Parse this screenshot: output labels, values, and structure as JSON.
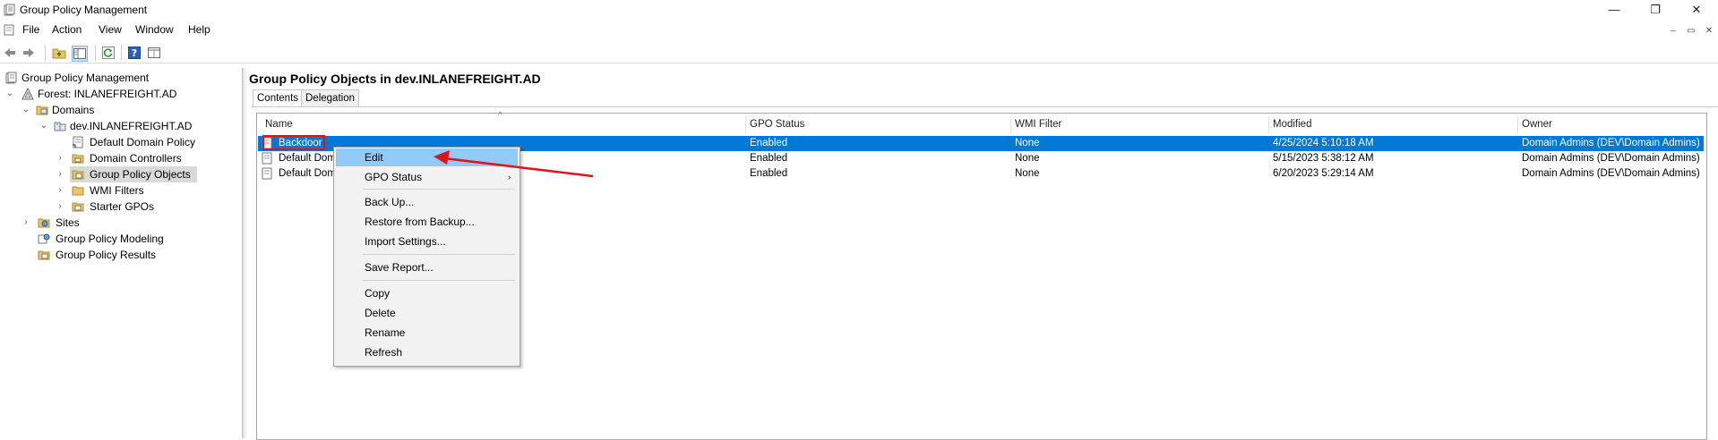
{
  "window": {
    "title": "Group Policy Management",
    "minimize_glyph": "—",
    "restore_glyph": "❐",
    "close_glyph": "✕"
  },
  "menubar": {
    "items": [
      "File",
      "Action",
      "View",
      "Window",
      "Help"
    ],
    "mdi_minimize": "–",
    "mdi_restore": "▭",
    "mdi_close": "✕"
  },
  "toolbar": {
    "buttons": [
      "back-icon",
      "forward-icon",
      "up-folder-icon",
      "show-hide-tree-icon",
      "refresh-icon",
      "help-icon",
      "properties-icon"
    ]
  },
  "tree": {
    "root": "Group Policy Management",
    "forest": "Forest: INLANEFREIGHT.AD",
    "domains": "Domains",
    "domain": "dev.INLANEFREIGHT.AD",
    "default_domain_policy": "Default Domain Policy",
    "domain_controllers": "Domain Controllers",
    "gpo_container": "Group Policy Objects",
    "wmi_filters": "WMI Filters",
    "starter_gpos": "Starter GPOs",
    "sites": "Sites",
    "modeling": "Group Policy Modeling",
    "results": "Group Policy Results"
  },
  "right_pane": {
    "title": "Group Policy Objects in dev.INLANEFREIGHT.AD",
    "tabs": [
      "Contents",
      "Delegation"
    ],
    "sort_glyph": "^",
    "columns": [
      "Name",
      "GPO Status",
      "WMI Filter",
      "Modified",
      "Owner"
    ],
    "rows": [
      {
        "name": "Backdoor",
        "status": "Enabled",
        "wmi": "None",
        "modified": "4/25/2024 5:10:18 AM",
        "owner": "Domain Admins (DEV\\Domain Admins)",
        "selected": true
      },
      {
        "name": "Default Doma",
        "status": "Enabled",
        "wmi": "None",
        "modified": "5/15/2023 5:38:12 AM",
        "owner": "Domain Admins (DEV\\Domain Admins)",
        "selected": false
      },
      {
        "name": "Default Doma",
        "status": "Enabled",
        "wmi": "None",
        "modified": "6/20/2023 5:29:14 AM",
        "owner": "Domain Admins (DEV\\Domain Admins)",
        "selected": false
      }
    ]
  },
  "context_menu": {
    "edit": "Edit",
    "gpo_status": "GPO Status",
    "backup": "Back Up...",
    "restore": "Restore from Backup...",
    "import": "Import Settings...",
    "save_report": "Save Report...",
    "copy": "Copy",
    "delete": "Delete",
    "rename": "Rename",
    "refresh": "Refresh",
    "submenu_arrow": "›"
  },
  "colors": {
    "selection_blue": "#0078d7",
    "menu_hover": "#91c9f7",
    "annotation_red": "#e0141b"
  }
}
